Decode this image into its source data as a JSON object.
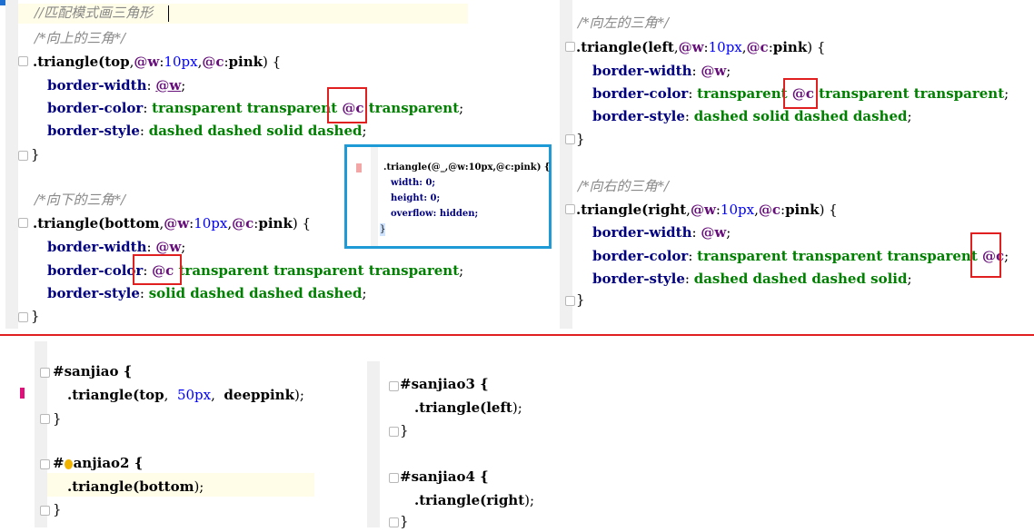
{
  "panel_left": {
    "header_comment": "//匹配模式画三角形",
    "up_comment": "/*向上的三角*/",
    "up_line": {
      "sel": ".triangle(",
      "arg1": "top",
      "arg2": "@w",
      "arg2b": ":",
      "arg3": "10px",
      "arg4": "@c",
      "arg5": ":",
      "arg6": "pink",
      "end": ") {"
    },
    "up_border_width": {
      "prop": "border-width",
      "colon": ": ",
      "val": "@w",
      "end": ";"
    },
    "up_border_color": {
      "prop": "border-color",
      "colon": ": ",
      "v1": "transparent transparent ",
      "var": "@c",
      "v2": " transparent",
      "end": ";"
    },
    "up_border_style": {
      "prop": "border-style",
      "colon": ": ",
      "val": "dashed dashed solid dashed",
      "end": ";"
    },
    "close1": "}",
    "down_comment": "/*向下的三角*/",
    "down_line": {
      "sel": ".triangle(",
      "arg1": "bottom",
      "arg2": "@w",
      "arg2b": ":",
      "arg3": "10px",
      "arg4": "@c",
      "arg5": ":",
      "arg6": "pink",
      "end": ") {"
    },
    "down_border_width": {
      "prop": "border-width",
      "colon": ": ",
      "val": "@w",
      "end": ";"
    },
    "down_border_color": {
      "prop": "border-color",
      "colon": ": ",
      "var": "@c",
      "v2": " transparent transparent transparent",
      "end": ";"
    },
    "down_border_style": {
      "prop": "border-style",
      "colon": ": ",
      "val": "solid dashed dashed dashed",
      "end": ";"
    },
    "close2": "}"
  },
  "popup": {
    "line1": ".triangle(@_,@w:10px,@c:pink) {",
    "line2": "width: 0;",
    "line3": "height: 0;",
    "line4": "overflow: hidden;",
    "line5": "}"
  },
  "panel_right": {
    "left_comment": "/*向左的三角*/",
    "left_line": {
      "sel": ".triangle(",
      "arg1": "left",
      "arg2": "@w",
      "arg2b": ":",
      "arg3": "10px",
      "arg4": "@c",
      "arg5": ":",
      "arg6": "pink",
      "end": ") {"
    },
    "left_border_width": {
      "prop": "border-width",
      "colon": ": ",
      "val": "@w",
      "end": ";"
    },
    "left_border_color": {
      "prop": "border-color",
      "colon": ": ",
      "v1": "transparent ",
      "var": "@c",
      "v2": " transparent transparent",
      "end": ";"
    },
    "left_border_style": {
      "prop": "border-style",
      "colon": ": ",
      "val": "dashed solid dashed dashed",
      "end": ";"
    },
    "close1": "}",
    "right_comment": "/*向右的三角*/",
    "right_line": {
      "sel": ".triangle(",
      "arg1": "right",
      "arg2": "@w",
      "arg2b": ":",
      "arg3": "10px",
      "arg4": "@c",
      "arg5": ":",
      "arg6": "pink",
      "end": ") {"
    },
    "right_border_width": {
      "prop": "border-width",
      "colon": ": ",
      "val": "@w",
      "end": ";"
    },
    "right_border_color": {
      "prop": "border-color",
      "colon": ": ",
      "v1": "transparent transparent transparent ",
      "var": "@c",
      "end": ";"
    },
    "right_border_style": {
      "prop": "border-style",
      "colon": ": ",
      "val": "dashed dashed dashed solid",
      "end": ";"
    },
    "close2": "}"
  },
  "bottom_left": {
    "s1": "#sanjiao {",
    "s1_call": {
      "sel": ".triangle(",
      "a1": "top",
      "c1": ",  ",
      "a2": "50px",
      "c2": ",  ",
      "a3": "deeppink",
      "end": ");"
    },
    "s1_close": "}",
    "s2_hash": "#",
    "s2_rest": "anjiao2 {",
    "s2_call": {
      "sel": ".triangle(",
      "a1": "bottom",
      "end": ");"
    },
    "s2_close": "}"
  },
  "bottom_right": {
    "s3": "#sanjiao3 {",
    "s3_call": {
      "sel": ".triangle(",
      "a1": "left",
      "end": ");"
    },
    "s3_close": "}",
    "s4": "#sanjiao4 {",
    "s4_call": {
      "sel": ".triangle(",
      "a1": "right",
      "end": ");"
    },
    "s4_close": "}"
  },
  "colors": {
    "accent_red": "#e02020",
    "popup_border": "#1e9bd7",
    "property": "#000080",
    "value": "#008000",
    "variable": "#660e7a",
    "number": "#0000ff",
    "comment": "#888888"
  }
}
